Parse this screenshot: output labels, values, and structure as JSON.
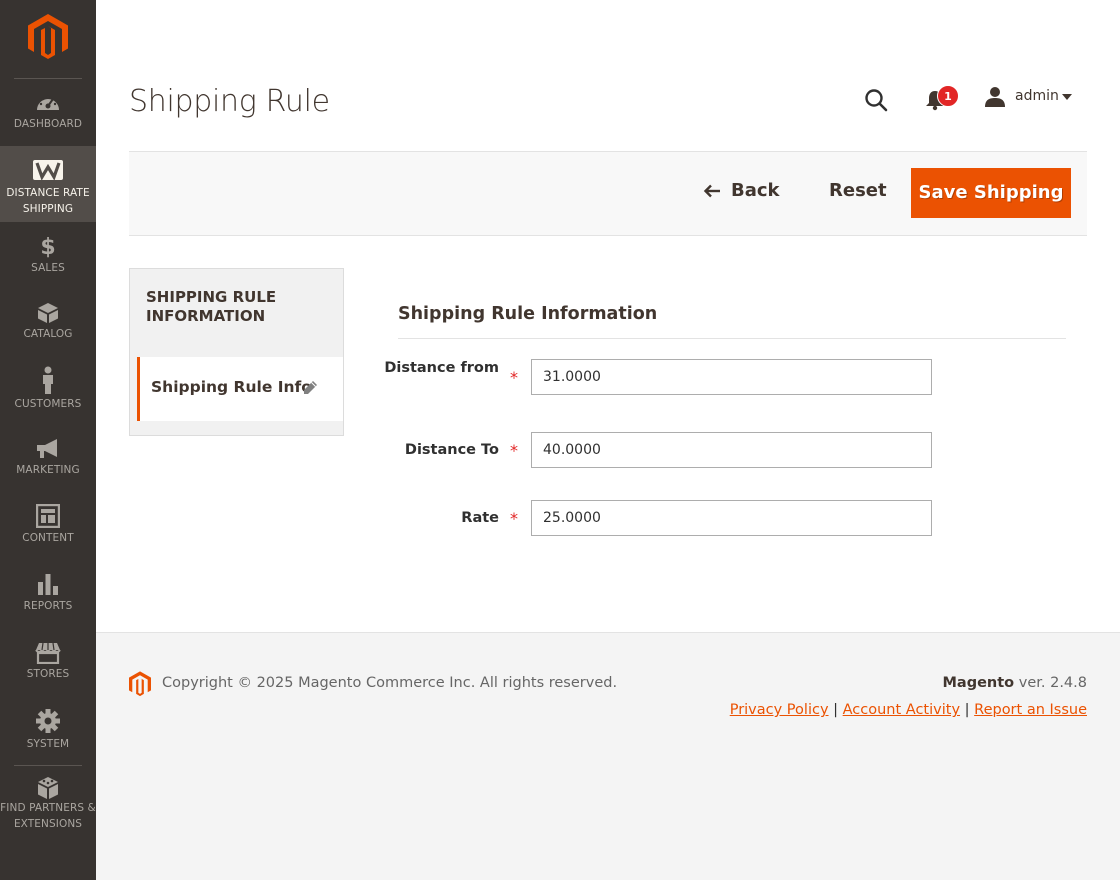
{
  "colors": {
    "accent": "#eb5202",
    "sidebar_bg": "#373330",
    "sidebar_active": "#524d49",
    "badge": "#e22626"
  },
  "sidebar": {
    "logo": "magento-logo-icon",
    "items": [
      {
        "label": "DASHBOARD",
        "icon": "dashboard-icon"
      },
      {
        "label": "DISTANCE RATE SHIPPING",
        "icon": "w-icon",
        "active": true
      },
      {
        "label": "SALES",
        "icon": "dollar-icon"
      },
      {
        "label": "CATALOG",
        "icon": "cube-icon"
      },
      {
        "label": "CUSTOMERS",
        "icon": "person-icon"
      },
      {
        "label": "MARKETING",
        "icon": "megaphone-icon"
      },
      {
        "label": "CONTENT",
        "icon": "layout-icon"
      },
      {
        "label": "REPORTS",
        "icon": "bar-chart-icon"
      },
      {
        "label": "STORES",
        "icon": "store-icon"
      },
      {
        "label": "SYSTEM",
        "icon": "gear-icon"
      },
      {
        "label": "FIND PARTNERS & EXTENSIONS",
        "icon": "blocks-icon"
      }
    ]
  },
  "header": {
    "title": "Shipping Rule",
    "notifications_count": "1",
    "user": "admin"
  },
  "actions": {
    "back": "Back",
    "reset": "Reset",
    "save": "Save Shipping"
  },
  "tabs": {
    "title": "SHIPPING RULE INFORMATION",
    "items": [
      {
        "label": "Shipping Rule Info"
      }
    ]
  },
  "form": {
    "section_title": "Shipping Rule Information",
    "fields": [
      {
        "label": "Distance from",
        "value": "31.0000",
        "required": true
      },
      {
        "label": "Distance To",
        "value": "40.0000",
        "required": true
      },
      {
        "label": "Rate",
        "value": "25.0000",
        "required": true
      }
    ]
  },
  "footer": {
    "copyright": "Copyright © 2025 Magento Commerce Inc. All rights reserved.",
    "brand": "Magento",
    "version": "ver. 2.4.8",
    "links": [
      "Privacy Policy",
      "Account Activity",
      "Report an Issue"
    ]
  }
}
